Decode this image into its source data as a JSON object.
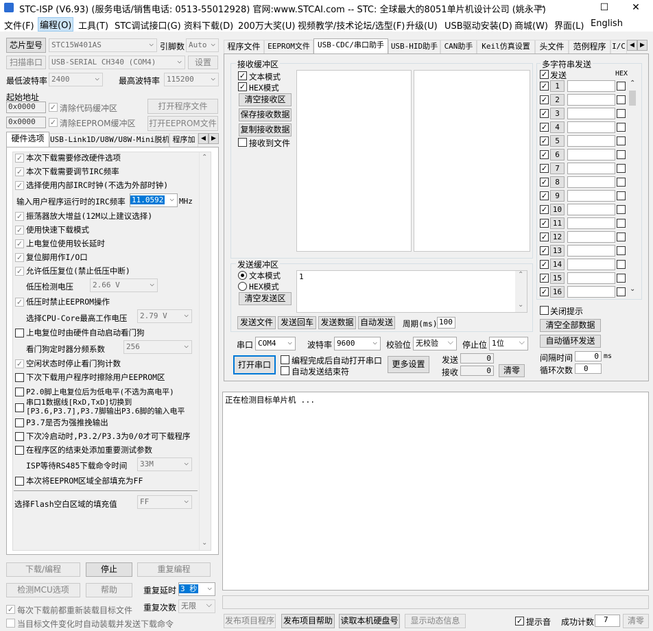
{
  "window": {
    "title": "STC-ISP (V6.93) (服务电话/销售电话: 0513-55012928) 官网:www.STCAI.com  -- STC: 全球最大的8051单片机设计公司 (姚永平)",
    "minimize": "─",
    "maximize": "☐",
    "close": "✕"
  },
  "menu": [
    "文件(F)",
    "编程(O)",
    "工具(T)",
    "STC调试接口(G)",
    "资料下载(D)",
    "200万大奖(U)",
    "视频教学/技术论坛/选型(F)",
    "升级(U)",
    "USB驱动安装(D)",
    "商城(W)",
    "界面(L)",
    "English"
  ],
  "left": {
    "chip_type_btn": "芯片型号",
    "chip_value": "STC15W401AS",
    "pin_label": "引脚数",
    "pin_value": "Auto",
    "scan_port_btn": "扫描串口",
    "port_value": "USB-SERIAL CH340 (COM4)",
    "settings_btn": "设置",
    "min_baud_label": "最低波特率",
    "min_baud_value": "2400",
    "max_baud_label": "最高波特率",
    "max_baud_value": "115200",
    "start_addr_label": "起始地址",
    "addr1": "0x0000",
    "clear_code": "清除代码缓冲区",
    "open_prog_btn": "打开程序文件",
    "addr2": "0x0000",
    "clear_eeprom": "清除EEPROM缓冲区",
    "open_eeprom_btn": "打开EEPROM文件",
    "tabs": [
      "硬件选项",
      "USB-Link1D/U8W/U8W-Mini脱机",
      "程序加"
    ],
    "hw": [
      {
        "t": "本次下载需要修改硬件选项",
        "c": true
      },
      {
        "t": "本次下载需要调节IRC频率",
        "c": true
      },
      {
        "t": "选择使用内部IRC时钟(不选为外部时钟)",
        "c": true
      },
      {
        "t": "振荡器放大增益(12M以上建议选择)",
        "c": true
      },
      {
        "t": "使用快速下载模式",
        "c": true
      },
      {
        "t": "上电复位使用较长延时",
        "c": true
      },
      {
        "t": "复位脚用作I/O口",
        "c": true
      },
      {
        "t": "允许低压复位(禁止低压中断)",
        "c": true
      },
      {
        "t": "低压时禁止EEPROM操作",
        "c": true
      },
      {
        "t": "上电复位时由硬件自动启动看门狗",
        "c": false
      },
      {
        "t": "空闲状态时停止看门狗计数",
        "c": true
      },
      {
        "t": "下次下载用户程序时擦除用户EEPROM区",
        "c": false
      },
      {
        "t": "P2.0脚上电复位后为低电平(不选为高电平)",
        "c": false
      },
      {
        "t": "串口1数据线[RxD,TxD]切换到",
        "c": false
      },
      {
        "t": "[P3.6,P3.7],P3.7脚输出P3.6脚的输入电平",
        "c": false
      },
      {
        "t": "P3.7是否为强推挽输出",
        "c": false
      },
      {
        "t": "下次冷启动时,P3.2/P3.3为0/0才可下载程序",
        "c": false
      },
      {
        "t": "在程序区的结束处添加重要测试参数",
        "c": false
      },
      {
        "t": "本次将EEPROM区域全部填充为FF",
        "c": false
      }
    ],
    "irc_label": "输入用户程序运行时的IRC频率",
    "irc_value": "11.0592",
    "irc_unit": "MHz",
    "lvd_label": "低压检测电压",
    "lvd_value": "2.66 V",
    "cpu_v_label": "选择CPU-Core最高工作电压",
    "cpu_v_value": "2.79 V",
    "wdt_label": "看门狗定时器分频系数",
    "wdt_value": "256",
    "isp_label": "ISP等待RS485下载命令时间",
    "isp_value": "33M",
    "flash_fill_label": "选择Flash空白区域的填充值",
    "flash_fill_value": "FF",
    "download_btn": "下载/编程",
    "stop_btn": "停止",
    "reprog_btn": "重复编程",
    "detect_btn": "检测MCU选项",
    "help_btn": "帮助",
    "retry_delay_label": "重复延时",
    "retry_delay_value": "3 秒",
    "retry_count_label": "重复次数",
    "retry_count_value": "无限",
    "reload_each": "每次下载前都重新装载目标文件",
    "auto_reload": "当目标文件变化时自动装载并发送下载命令"
  },
  "right": {
    "tabs": [
      "程序文件",
      "EEPROM文件",
      "USB-CDC/串口助手",
      "USB-HID助手",
      "CAN助手",
      "Keil仿真设置",
      "头文件",
      "范例程序",
      "I/C"
    ],
    "recv_title": "接收缓冲区",
    "recv_text_mode": "文本模式",
    "recv_hex_mode": "HEX模式",
    "clear_recv": "清空接收区",
    "save_recv": "保存接收数据",
    "copy_recv": "复制接收数据",
    "recv_to_file": "接收到文件",
    "send_title": "发送缓冲区",
    "send_text_mode": "文本模式",
    "send_hex_mode": "HEX模式",
    "clear_send": "清空发送区",
    "send_content": "1",
    "send_file": "发送文件",
    "send_cr": "发送回车",
    "send_data": "发送数据",
    "auto_send": "自动发送",
    "period_label": "周期(ms)",
    "period_value": "100",
    "port_label": "串口",
    "port_value": "COM4",
    "baud_label": "波特率",
    "baud_value": "9600",
    "parity_label": "校验位",
    "parity_value": "无校验",
    "stop_label": "停止位",
    "stop_value": "1位",
    "open_port": "打开串口",
    "auto_open": "编程完成后自动打开串口",
    "auto_send_end": "自动发送结束符",
    "more_settings": "更多设置",
    "sent_label": "发送",
    "sent_value": "0",
    "recv_label": "接收",
    "recv_value": "0",
    "clear_counts": "清零",
    "multi_title": "多字符串发送",
    "multi_send_hdr": "发送",
    "multi_hex_hdr": "HEX",
    "multi_rows": [
      "1",
      "2",
      "3",
      "4",
      "5",
      "6",
      "7",
      "8",
      "9",
      "10",
      "11",
      "12",
      "13",
      "14",
      "15",
      "16"
    ],
    "close_hint": "关闭提示",
    "clear_all": "清空全部数据",
    "auto_cycle": "自动循环发送",
    "interval_label": "间隔时间",
    "interval_value": "0",
    "interval_unit": "ms",
    "cycle_count_label": "循环次数",
    "cycle_count_value": "0"
  },
  "log": {
    "text": "正在检测目标单片机 ..."
  },
  "bottom": {
    "publish_prog": "发布项目程序",
    "publish_help": "发布项目帮助",
    "read_disk": "读取本机硬盘号",
    "show_dynamic": "显示动态信息",
    "beep": "提示音",
    "success_label": "成功计数",
    "success_value": "7",
    "clear": "清零"
  }
}
